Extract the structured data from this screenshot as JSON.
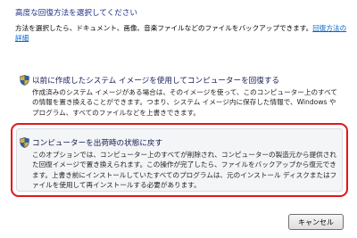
{
  "header": {
    "title": "高度な回復方法を選択してください"
  },
  "intro": {
    "text": "方法を選択したら、ドキュメント、画像、音楽ファイルなどのファイルをバックアップできます。",
    "link": "回復方法の詳細"
  },
  "options": [
    {
      "title": "以前に作成したシステム イメージを使用してコンピューターを回復する",
      "description": "作成済みのシステム イメージがある場合は、そのイメージを使って、このコンピューター上のすべての情報を置き換えることができます。つまり、システム イメージ内に保存した情報で、Windows やプログラム、すべてのファイルなどを上書きできます。",
      "icon": "uac-shield-icon"
    },
    {
      "title": "コンピューターを出荷時の状態に戻す",
      "description": "このオプションでは、コンピューター上のすべてが削除され、コンピューターの製造元から提供された回復イメージで置き換えられます。この操作が完了したら、ファイルをバックアップから復元できます。上書き前にインストールしていたすべてのプログラムは、元のインストール ディスクまたはファイルを使用して再インストールする必要があります。",
      "icon": "uac-shield-icon"
    }
  ],
  "footer": {
    "cancel_label": "キャンセル"
  },
  "colors": {
    "heading": "#1e3287",
    "link": "#0066cc",
    "highlight": "#e0161e"
  }
}
